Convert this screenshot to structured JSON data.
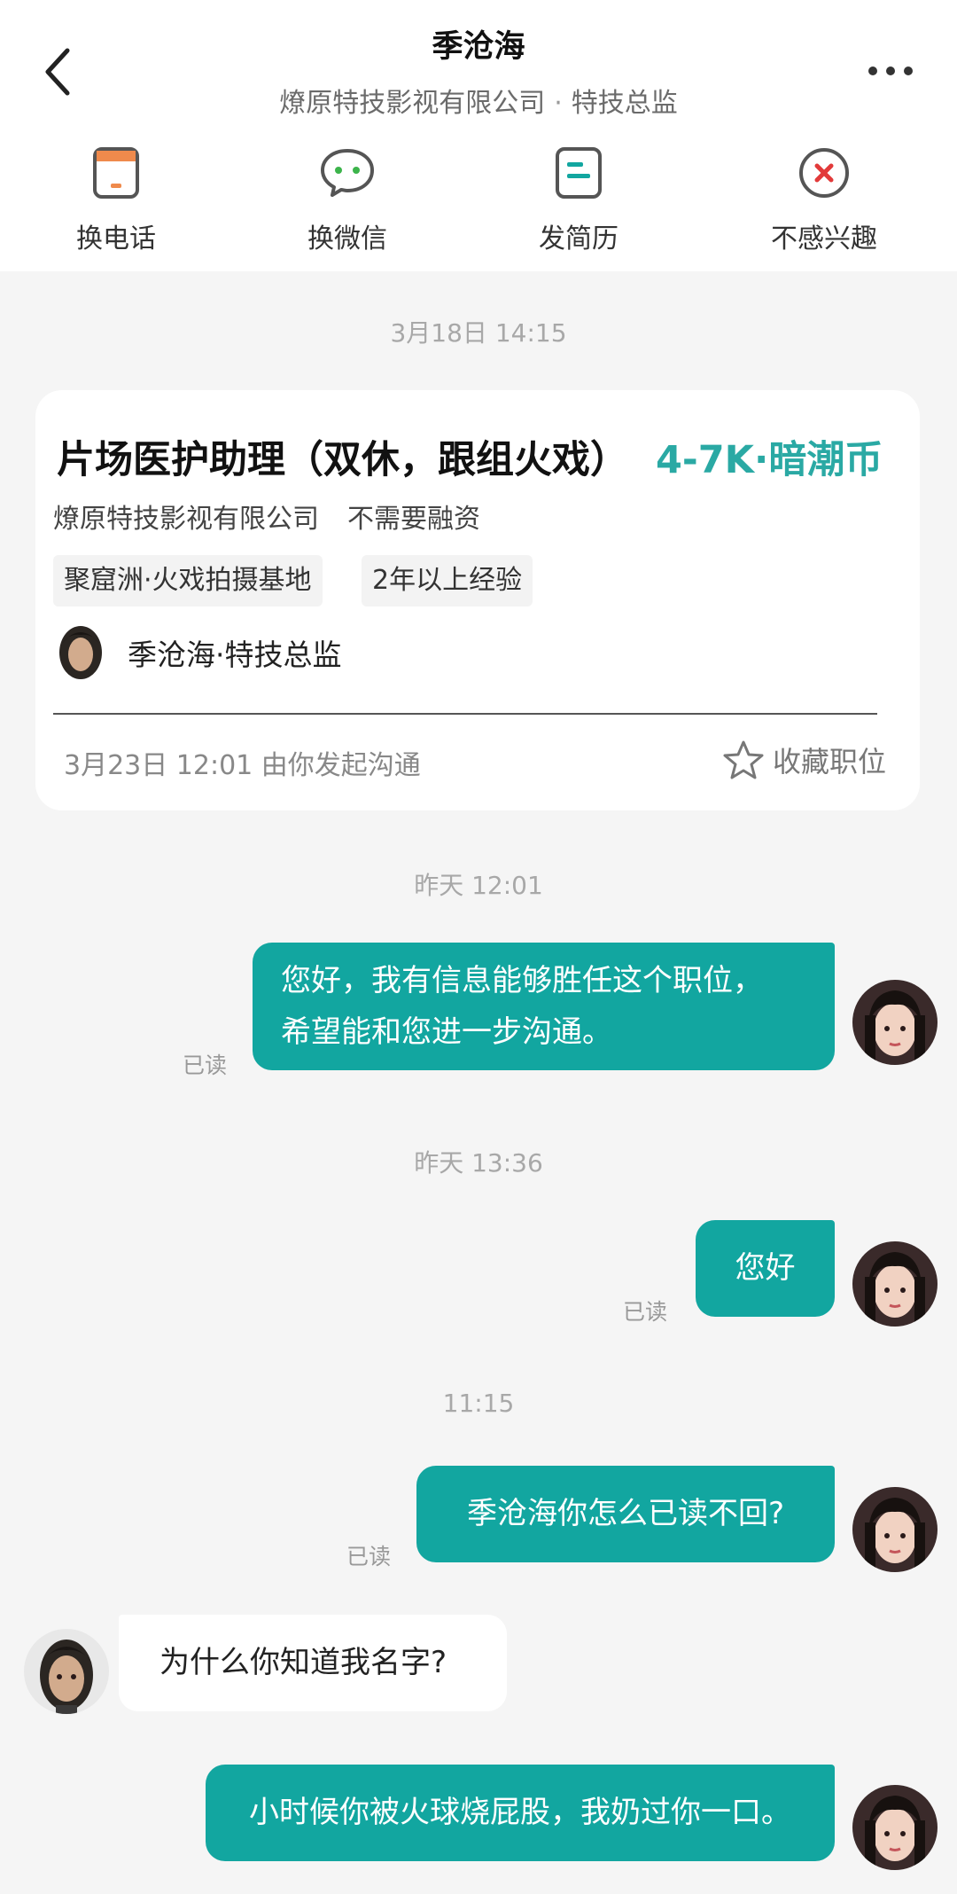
{
  "header": {
    "title": "季沧海",
    "company": "燎原特技影视有限公司",
    "dot": "·",
    "position": "特技总监",
    "actions": [
      {
        "label": "换电话",
        "icon": "phone-icon"
      },
      {
        "label": "换微信",
        "icon": "wechat-icon"
      },
      {
        "label": "发简历",
        "icon": "resume-icon"
      },
      {
        "label": "不感兴趣",
        "icon": "not-interested-icon"
      }
    ]
  },
  "colors": {
    "accent": "#12a6a0",
    "salary": "#2aa9a4",
    "phone_icon": "#ef8a4c",
    "reject_icon": "#e23a3a",
    "background": "#f5f5f5"
  },
  "job_card": {
    "time": "3月18日 14:15",
    "title": "片场医护助理（双休，跟组火戏）",
    "salary": "4-7K·暗潮币",
    "company": "燎原特技影视有限公司",
    "financing": "不需要融资",
    "tags": [
      "聚窟洲·火戏拍摄基地",
      "2年以上经验"
    ],
    "recruiter": "季沧海·特技总监",
    "footer": "3月23日  12:01 由你发起沟通",
    "favorite_label": "收藏职位"
  },
  "messages": [
    {
      "time": "昨天  12:01",
      "lines": [
        "您好，我有信息能够胜任这个职位，",
        "希望能和您进一步沟通。"
      ],
      "read": "已读"
    },
    {
      "time": "昨天  13:36",
      "text": "您好",
      "read": "已读"
    },
    {
      "time": "11:15",
      "text": "季沧海你怎么已读不回?",
      "read": "已读"
    },
    {
      "text": "为什么你知道我名字?"
    },
    {
      "text": "小时候你被火球烧屁股，我奶过你一口。"
    }
  ]
}
